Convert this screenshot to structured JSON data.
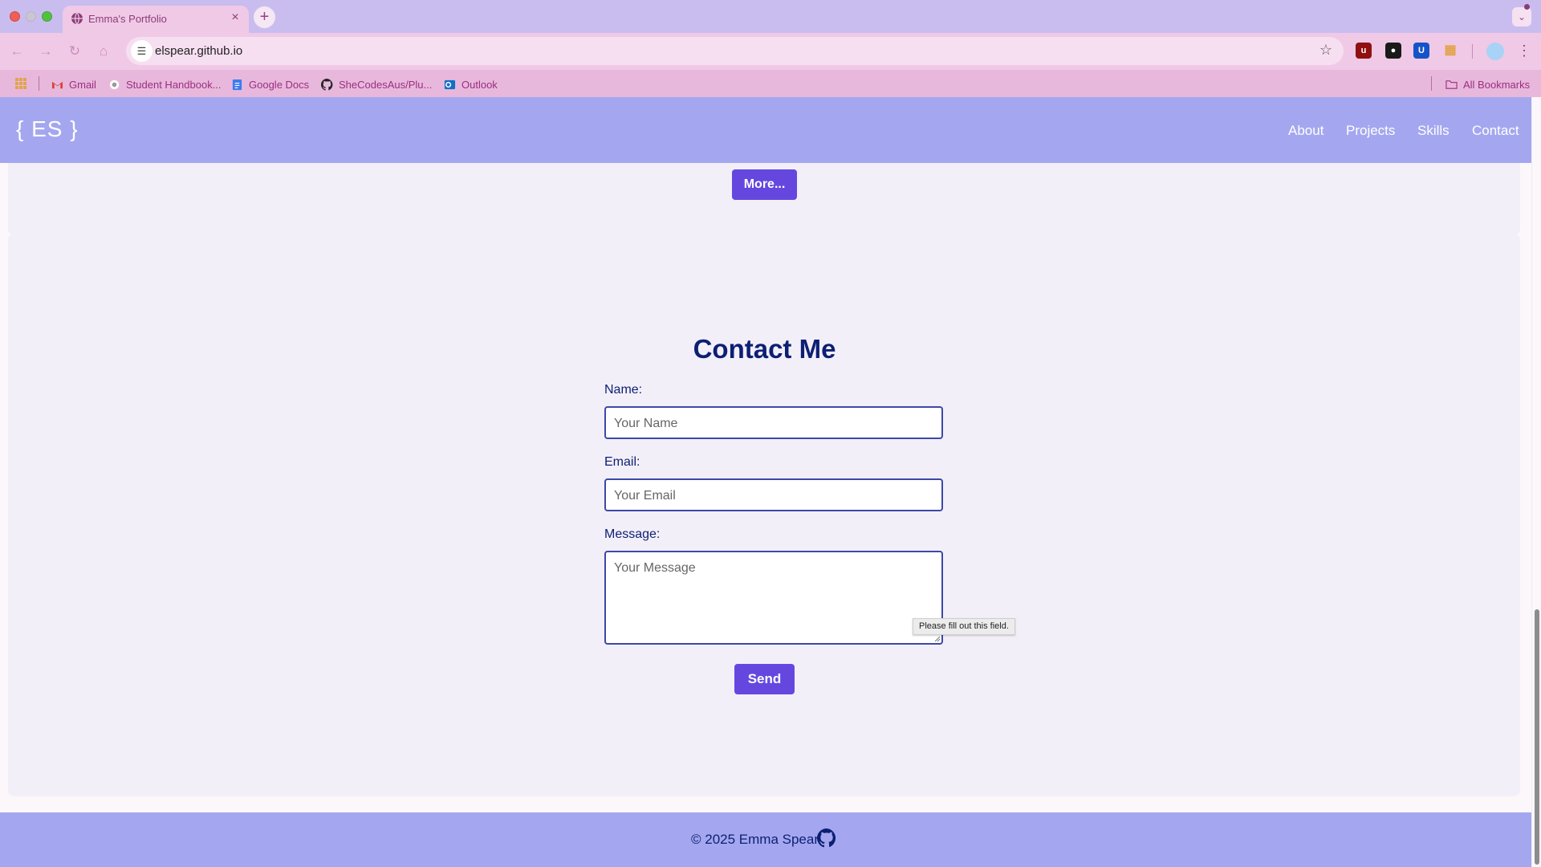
{
  "browser": {
    "tab_title": "Emma's Portfolio",
    "tab_close": "×",
    "new_tab": "+",
    "url": "elspear.github.io",
    "bookmarks": [
      "Gmail",
      "Student Handbook...",
      "Google Docs",
      "SheCodesAus/Plu...",
      "Outlook"
    ],
    "all_bookmarks": "All Bookmarks",
    "extensions": [
      "ublock-origin-icon",
      "lock-extension-icon",
      "bitwarden-icon",
      "puzzle-extensions-icon"
    ]
  },
  "site": {
    "logo": "{ ES }",
    "nav": [
      "About",
      "Projects",
      "Skills",
      "Contact"
    ],
    "more_button": "More..."
  },
  "contact": {
    "title": "Contact Me",
    "name_label": "Name:",
    "name_placeholder": "Your Name",
    "email_label": "Email:",
    "email_placeholder": "Your Email",
    "message_label": "Message:",
    "message_placeholder": "Your Message",
    "validation_tooltip": "Please fill out this field.",
    "send_button": "Send"
  },
  "footer": {
    "text": "© 2025 Emma Spear",
    "icon": "github-icon"
  },
  "colors": {
    "nav_bg": "#a4a7ef",
    "accent_button": "#6547e0",
    "heading": "#0c1f73",
    "card_bg": "#f3eff8"
  }
}
